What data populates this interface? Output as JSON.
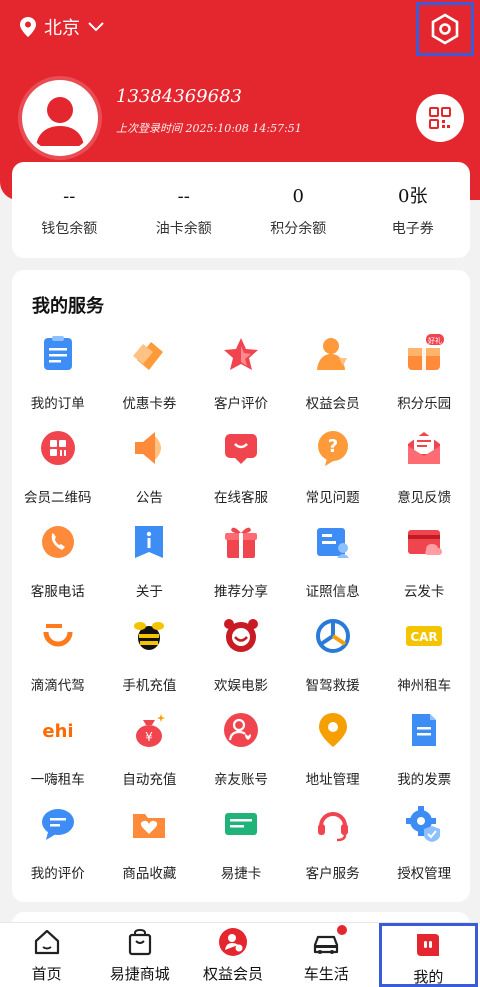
{
  "header": {
    "city": "北京",
    "phone": "13384369683",
    "last_login": "上次登录时间 2025:10:08 14:57:51",
    "brand_color": "#e4262e"
  },
  "stats": [
    {
      "value": "--",
      "label": "钱包余额"
    },
    {
      "value": "--",
      "label": "油卡余额"
    },
    {
      "value": "0",
      "label": "积分余额"
    },
    {
      "value": "0张",
      "label": "电子券"
    }
  ],
  "services": {
    "title": "我的服务",
    "items": [
      {
        "label": "我的订单",
        "icon": "order-icon"
      },
      {
        "label": "优惠卡券",
        "icon": "coupon-icon"
      },
      {
        "label": "客户评价",
        "icon": "star-icon"
      },
      {
        "label": "权益会员",
        "icon": "member-icon"
      },
      {
        "label": "积分乐园",
        "icon": "gift-box-icon"
      },
      {
        "label": "会员二维码",
        "icon": "qr-code-icon"
      },
      {
        "label": "公告",
        "icon": "speaker-icon"
      },
      {
        "label": "在线客服",
        "icon": "chat-icon"
      },
      {
        "label": "常见问题",
        "icon": "question-icon"
      },
      {
        "label": "意见反馈",
        "icon": "feedback-icon"
      },
      {
        "label": "客服电话",
        "icon": "phone-icon"
      },
      {
        "label": "关于",
        "icon": "info-icon"
      },
      {
        "label": "推荐分享",
        "icon": "share-gift-icon"
      },
      {
        "label": "证照信息",
        "icon": "license-icon"
      },
      {
        "label": "云发卡",
        "icon": "card-icon"
      },
      {
        "label": "滴滴代驾",
        "icon": "didi-icon"
      },
      {
        "label": "手机充值",
        "icon": "bee-icon"
      },
      {
        "label": "欢娱电影",
        "icon": "movie-icon"
      },
      {
        "label": "智驾救援",
        "icon": "rescue-icon"
      },
      {
        "label": "神州租车",
        "icon": "car-rental-icon"
      },
      {
        "label": "一嗨租车",
        "icon": "ehi-icon"
      },
      {
        "label": "自动充值",
        "icon": "money-bag-icon"
      },
      {
        "label": "亲友账号",
        "icon": "family-icon"
      },
      {
        "label": "地址管理",
        "icon": "location-icon"
      },
      {
        "label": "我的发票",
        "icon": "invoice-icon"
      },
      {
        "label": "我的评价",
        "icon": "comment-icon"
      },
      {
        "label": "商品收藏",
        "icon": "favorite-icon"
      },
      {
        "label": "易捷卡",
        "icon": "yijie-card-icon"
      },
      {
        "label": "客户服务",
        "icon": "headset-icon"
      },
      {
        "label": "授权管理",
        "icon": "gear-shield-icon"
      }
    ]
  },
  "ehi_text": "ehi",
  "car_text": "CAR",
  "gift_badge": "好礼",
  "tabbar": [
    {
      "label": "首页",
      "icon": "home-icon"
    },
    {
      "label": "易捷商城",
      "icon": "shopping-bag-icon"
    },
    {
      "label": "权益会员",
      "icon": "member-badge-icon"
    },
    {
      "label": "车生活",
      "icon": "car-icon"
    },
    {
      "label": "我的",
      "icon": "profile-icon"
    }
  ]
}
